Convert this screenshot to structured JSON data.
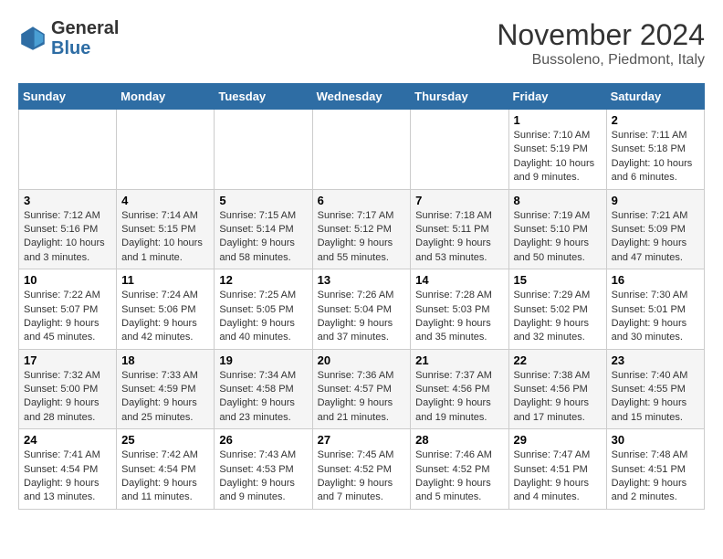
{
  "header": {
    "logo_general": "General",
    "logo_blue": "Blue",
    "month_year": "November 2024",
    "location": "Bussoleno, Piedmont, Italy"
  },
  "columns": [
    "Sunday",
    "Monday",
    "Tuesday",
    "Wednesday",
    "Thursday",
    "Friday",
    "Saturday"
  ],
  "weeks": [
    [
      {
        "day": "",
        "info": ""
      },
      {
        "day": "",
        "info": ""
      },
      {
        "day": "",
        "info": ""
      },
      {
        "day": "",
        "info": ""
      },
      {
        "day": "",
        "info": ""
      },
      {
        "day": "1",
        "info": "Sunrise: 7:10 AM\nSunset: 5:19 PM\nDaylight: 10 hours and 9 minutes."
      },
      {
        "day": "2",
        "info": "Sunrise: 7:11 AM\nSunset: 5:18 PM\nDaylight: 10 hours and 6 minutes."
      }
    ],
    [
      {
        "day": "3",
        "info": "Sunrise: 7:12 AM\nSunset: 5:16 PM\nDaylight: 10 hours and 3 minutes."
      },
      {
        "day": "4",
        "info": "Sunrise: 7:14 AM\nSunset: 5:15 PM\nDaylight: 10 hours and 1 minute."
      },
      {
        "day": "5",
        "info": "Sunrise: 7:15 AM\nSunset: 5:14 PM\nDaylight: 9 hours and 58 minutes."
      },
      {
        "day": "6",
        "info": "Sunrise: 7:17 AM\nSunset: 5:12 PM\nDaylight: 9 hours and 55 minutes."
      },
      {
        "day": "7",
        "info": "Sunrise: 7:18 AM\nSunset: 5:11 PM\nDaylight: 9 hours and 53 minutes."
      },
      {
        "day": "8",
        "info": "Sunrise: 7:19 AM\nSunset: 5:10 PM\nDaylight: 9 hours and 50 minutes."
      },
      {
        "day": "9",
        "info": "Sunrise: 7:21 AM\nSunset: 5:09 PM\nDaylight: 9 hours and 47 minutes."
      }
    ],
    [
      {
        "day": "10",
        "info": "Sunrise: 7:22 AM\nSunset: 5:07 PM\nDaylight: 9 hours and 45 minutes."
      },
      {
        "day": "11",
        "info": "Sunrise: 7:24 AM\nSunset: 5:06 PM\nDaylight: 9 hours and 42 minutes."
      },
      {
        "day": "12",
        "info": "Sunrise: 7:25 AM\nSunset: 5:05 PM\nDaylight: 9 hours and 40 minutes."
      },
      {
        "day": "13",
        "info": "Sunrise: 7:26 AM\nSunset: 5:04 PM\nDaylight: 9 hours and 37 minutes."
      },
      {
        "day": "14",
        "info": "Sunrise: 7:28 AM\nSunset: 5:03 PM\nDaylight: 9 hours and 35 minutes."
      },
      {
        "day": "15",
        "info": "Sunrise: 7:29 AM\nSunset: 5:02 PM\nDaylight: 9 hours and 32 minutes."
      },
      {
        "day": "16",
        "info": "Sunrise: 7:30 AM\nSunset: 5:01 PM\nDaylight: 9 hours and 30 minutes."
      }
    ],
    [
      {
        "day": "17",
        "info": "Sunrise: 7:32 AM\nSunset: 5:00 PM\nDaylight: 9 hours and 28 minutes."
      },
      {
        "day": "18",
        "info": "Sunrise: 7:33 AM\nSunset: 4:59 PM\nDaylight: 9 hours and 25 minutes."
      },
      {
        "day": "19",
        "info": "Sunrise: 7:34 AM\nSunset: 4:58 PM\nDaylight: 9 hours and 23 minutes."
      },
      {
        "day": "20",
        "info": "Sunrise: 7:36 AM\nSunset: 4:57 PM\nDaylight: 9 hours and 21 minutes."
      },
      {
        "day": "21",
        "info": "Sunrise: 7:37 AM\nSunset: 4:56 PM\nDaylight: 9 hours and 19 minutes."
      },
      {
        "day": "22",
        "info": "Sunrise: 7:38 AM\nSunset: 4:56 PM\nDaylight: 9 hours and 17 minutes."
      },
      {
        "day": "23",
        "info": "Sunrise: 7:40 AM\nSunset: 4:55 PM\nDaylight: 9 hours and 15 minutes."
      }
    ],
    [
      {
        "day": "24",
        "info": "Sunrise: 7:41 AM\nSunset: 4:54 PM\nDaylight: 9 hours and 13 minutes."
      },
      {
        "day": "25",
        "info": "Sunrise: 7:42 AM\nSunset: 4:54 PM\nDaylight: 9 hours and 11 minutes."
      },
      {
        "day": "26",
        "info": "Sunrise: 7:43 AM\nSunset: 4:53 PM\nDaylight: 9 hours and 9 minutes."
      },
      {
        "day": "27",
        "info": "Sunrise: 7:45 AM\nSunset: 4:52 PM\nDaylight: 9 hours and 7 minutes."
      },
      {
        "day": "28",
        "info": "Sunrise: 7:46 AM\nSunset: 4:52 PM\nDaylight: 9 hours and 5 minutes."
      },
      {
        "day": "29",
        "info": "Sunrise: 7:47 AM\nSunset: 4:51 PM\nDaylight: 9 hours and 4 minutes."
      },
      {
        "day": "30",
        "info": "Sunrise: 7:48 AM\nSunset: 4:51 PM\nDaylight: 9 hours and 2 minutes."
      }
    ]
  ]
}
